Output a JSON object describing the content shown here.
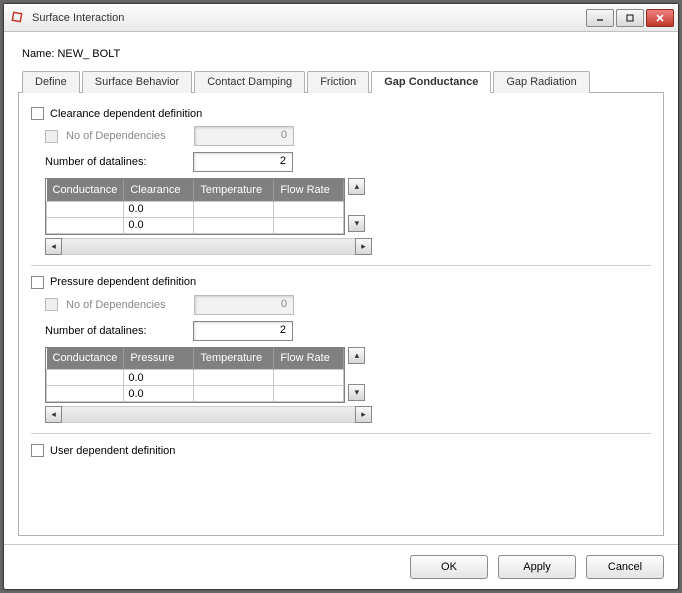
{
  "window": {
    "title": "Surface Interaction"
  },
  "name_label": "Name:",
  "name_value": "NEW_ BOLT",
  "tabs": {
    "define": "Define",
    "surface_behavior": "Surface Behavior",
    "contact_damping": "Contact Damping",
    "friction": "Friction",
    "gap_conductance": "Gap Conductance",
    "gap_radiation": "Gap Radiation"
  },
  "clearance": {
    "chk_label": "Clearance dependent definition",
    "nodeps_label": "No of Dependencies",
    "nodeps_value": "0",
    "datalines_label": "Number of datalines:",
    "datalines_value": "2",
    "headers": {
      "conductance": "Conductance",
      "second": "Clearance",
      "temperature": "Temperature",
      "flowrate": "Flow Rate"
    },
    "rows": [
      {
        "conductance": "",
        "second": "0.0",
        "temperature": "",
        "flowrate": ""
      },
      {
        "conductance": "",
        "second": "0.0",
        "temperature": "",
        "flowrate": ""
      }
    ]
  },
  "pressure": {
    "chk_label": "Pressure dependent definition",
    "nodeps_label": "No of Dependencies",
    "nodeps_value": "0",
    "datalines_label": "Number of datalines:",
    "datalines_value": "2",
    "headers": {
      "conductance": "Conductance",
      "second": "Pressure",
      "temperature": "Temperature",
      "flowrate": "Flow Rate"
    },
    "rows": [
      {
        "conductance": "",
        "second": "0.0",
        "temperature": "",
        "flowrate": ""
      },
      {
        "conductance": "",
        "second": "0.0",
        "temperature": "",
        "flowrate": ""
      }
    ]
  },
  "user": {
    "chk_label": "User dependent definition"
  },
  "buttons": {
    "ok": "OK",
    "apply": "Apply",
    "cancel": "Cancel"
  }
}
